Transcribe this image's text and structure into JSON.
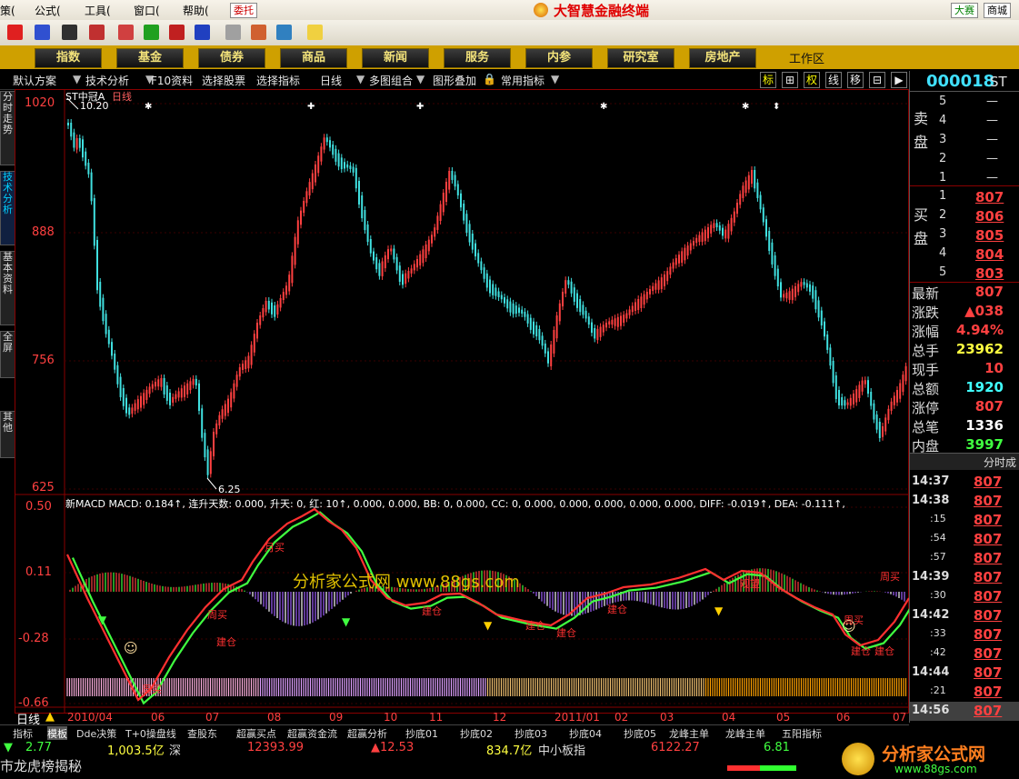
{
  "menu": {
    "items": [
      "策(",
      "公式(",
      "工具(",
      "窗口(",
      "帮助("
    ],
    "title": "大智慧金融终端",
    "left_tag": "委托",
    "right_tags": [
      "大赛",
      "商城"
    ]
  },
  "nav": {
    "buttons": [
      "指数",
      "基金",
      "债券",
      "商品",
      "新闻",
      "服务",
      "内参",
      "研究室",
      "房地产"
    ],
    "workspace": "工作区"
  },
  "chart_toolbar": {
    "items": [
      "默认方案",
      "技术分析",
      "F10资料",
      "选择股票",
      "选择指标",
      "日线",
      "多图组合",
      "图形叠加",
      "常用指标"
    ],
    "right_items": [
      "标",
      "⊞",
      "权",
      "线",
      "移",
      "⊟",
      "▶"
    ]
  },
  "left_tabs": [
    "分时走势",
    "技术分析",
    "基本资料",
    "全屏",
    "其他"
  ],
  "price_chart": {
    "stock_label": "ST中冠A",
    "period_label": "日线",
    "high_annot": "10.20",
    "low_annot": "6.25",
    "y_ticks": [
      "1020",
      "888",
      "756",
      "625"
    ]
  },
  "macd_chart": {
    "header": "新MACD  MACD: 0.184↑, 连升天数: 0.000, 升天: 0, 红: 10↑, 0.000, 0.000, BB: 0, 0.000, CC: 0, 0.000, 0.000, 0.000, 0.000, 0.000, DIFF: -0.019↑, DEA: -0.111↑,",
    "y_ticks": [
      "0.50",
      "0.11",
      "-0.28",
      "-0.66"
    ],
    "watermark": "分析家公式网 www.88gs.com",
    "annotations": [
      "周买",
      "月买",
      "建仓",
      "建仓",
      "建仓",
      "建仓",
      "建仓",
      "建仓",
      "建仓",
      "观望",
      "周买",
      "周买",
      "周买"
    ]
  },
  "x_axis": {
    "period": "日线",
    "labels": [
      "2010/04",
      "06",
      "07",
      "08",
      "09",
      "10",
      "11",
      "12",
      "2011/01",
      "02",
      "03",
      "04",
      "05",
      "06",
      "07"
    ]
  },
  "quote": {
    "code": "000018",
    "name_prefix": "ST",
    "sell_side": "卖盘",
    "buy_side": "买盘",
    "sell_levels": [
      {
        "n": "5",
        "p": "—"
      },
      {
        "n": "4",
        "p": "—"
      },
      {
        "n": "3",
        "p": "—"
      },
      {
        "n": "2",
        "p": "—"
      },
      {
        "n": "1",
        "p": "—"
      }
    ],
    "buy_levels": [
      {
        "n": "1",
        "p": "807"
      },
      {
        "n": "2",
        "p": "806"
      },
      {
        "n": "3",
        "p": "805"
      },
      {
        "n": "4",
        "p": "804"
      },
      {
        "n": "5",
        "p": "803"
      }
    ],
    "stats": [
      {
        "label": "最新",
        "value": "807",
        "color": "#ff4040"
      },
      {
        "label": "涨跌",
        "value": "▲038",
        "color": "#ff4040"
      },
      {
        "label": "涨幅",
        "value": "4.94%",
        "color": "#ff4040"
      },
      {
        "label": "总手",
        "value": "23962",
        "color": "#ffff40"
      },
      {
        "label": "现手",
        "value": "10",
        "color": "#ff4040"
      },
      {
        "label": "总额",
        "value": "1920",
        "color": "#40ffff"
      },
      {
        "label": "涨停",
        "value": "807",
        "color": "#ff4040"
      },
      {
        "label": "总笔",
        "value": "1336",
        "color": "#ffffff"
      },
      {
        "label": "内盘",
        "value": "3997",
        "color": "#40ff40"
      }
    ],
    "ticks_header": "分时成",
    "ticks": [
      {
        "t": "14:37",
        "p": "807"
      },
      {
        "t": "14:38",
        "p": "807"
      },
      {
        "t": ":15",
        "p": "807"
      },
      {
        "t": ":54",
        "p": "807"
      },
      {
        "t": ":57",
        "p": "807"
      },
      {
        "t": "14:39",
        "p": "807"
      },
      {
        "t": ":30",
        "p": "807"
      },
      {
        "t": "14:42",
        "p": "807"
      },
      {
        "t": ":33",
        "p": "807"
      },
      {
        "t": ":42",
        "p": "807"
      },
      {
        "t": "14:44",
        "p": "807"
      },
      {
        "t": ":21",
        "p": "807"
      },
      {
        "t": "14:56",
        "p": "807"
      }
    ]
  },
  "bottom_tabs": [
    "指标",
    "模板",
    "Dde决策",
    "T+0操盘线",
    "查股东",
    "超赢买点",
    "超赢资金流",
    "超赢分析",
    "抄底01",
    "抄底02",
    "抄底03",
    "抄底04",
    "抄底05",
    "龙峰主单",
    "龙峰主单",
    "五阳指标"
  ],
  "status": {
    "v1": "2.77",
    "v2": "1,003.5亿",
    "v2_suffix": "深",
    "v3": "12393.99",
    "v4": "▲12.53",
    "v5": "834.7亿",
    "v5_suffix": "中小板指",
    "v6": "6122.27",
    "v7": "6.81",
    "bottom_text": "市龙虎榜揭秘",
    "brand": "分析家公式网",
    "brand_url": "www.88gs.com"
  },
  "colors": {
    "up": "#ff4040",
    "down": "#40e0e0",
    "accent_gold": "#cfa000",
    "nav_text": "#f2e27a"
  }
}
